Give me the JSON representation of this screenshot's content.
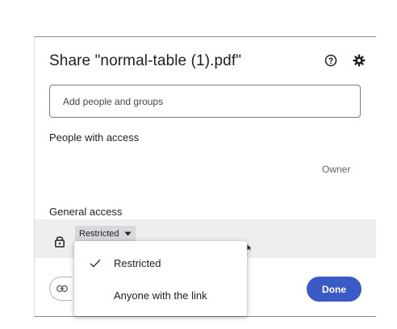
{
  "dialog": {
    "title": "Share \"normal-table (1).pdf\"",
    "help_icon": "help-circle-icon",
    "settings_icon": "gear-icon"
  },
  "add_people": {
    "placeholder": "Add people and groups"
  },
  "people_with_access": {
    "heading": "People with access",
    "owner_label": "Owner"
  },
  "general_access": {
    "heading": "General access",
    "icon": "lock-icon",
    "selected": "Restricted"
  },
  "dropdown": {
    "options": [
      {
        "label": "Restricted",
        "selected": true
      },
      {
        "label": "Anyone with the link",
        "selected": false
      }
    ]
  },
  "footer": {
    "copy_link_icon": "link-icon",
    "done_label": "Done"
  },
  "colors": {
    "primary": "#3a5bc7",
    "access_row_bg": "#eceeef"
  }
}
